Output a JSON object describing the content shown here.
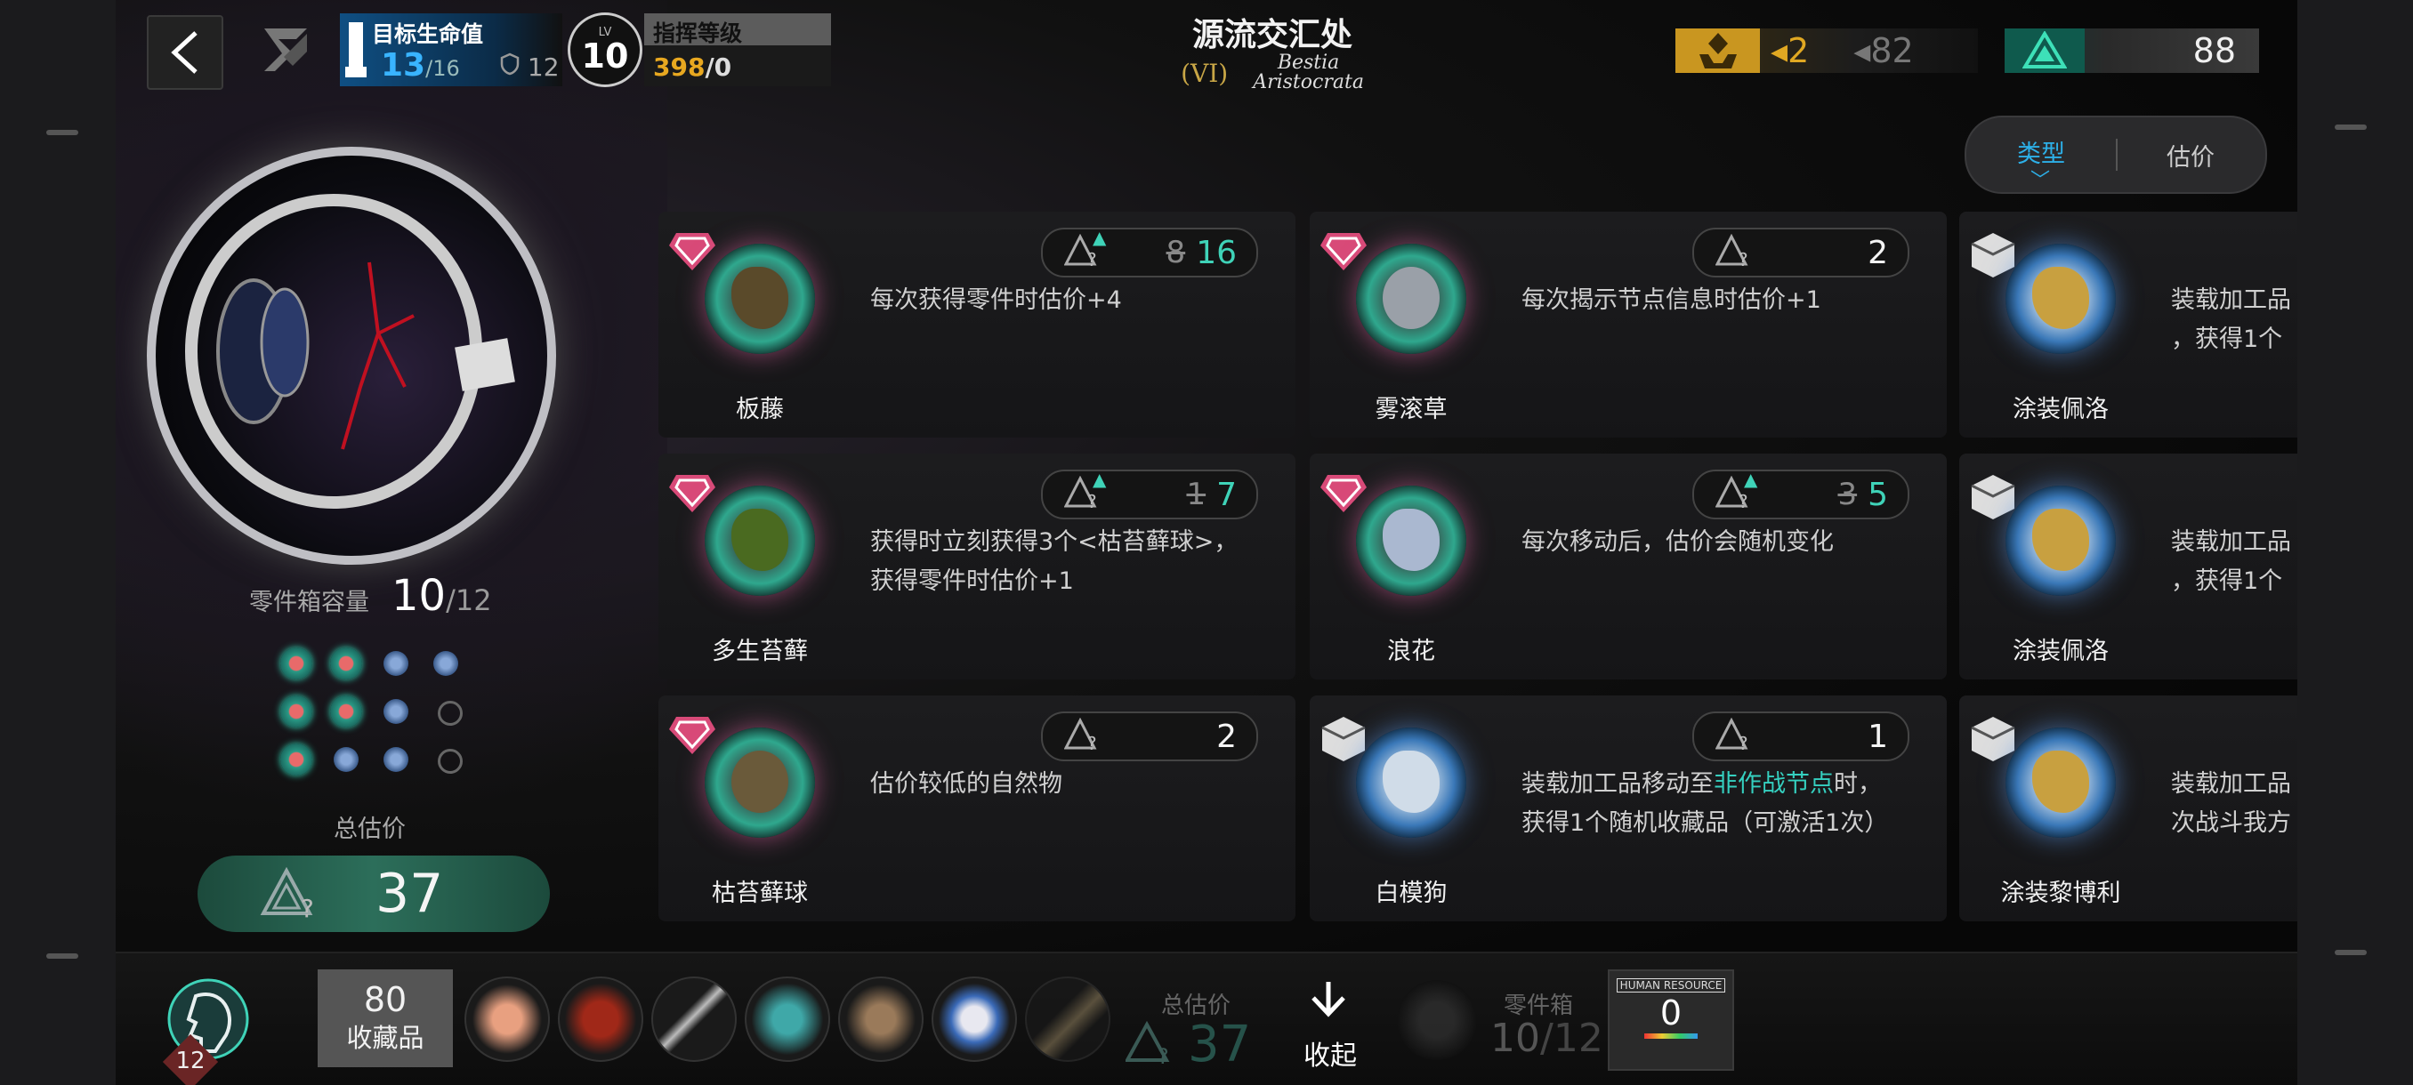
{
  "header": {
    "hp_label": "目标生命值",
    "hp_value": "13",
    "hp_max": "/16",
    "shield_value": "12",
    "lv_small": "LV",
    "lv_value": "10",
    "command_label": "指挥等级",
    "command_value": "398",
    "command_max": "/0"
  },
  "zone": {
    "title": "源流交汇处",
    "roman": "(VI)",
    "script_line1": "Bestia",
    "script_line2": "Aristocrata"
  },
  "resources": {
    "gold_value": "◂2",
    "gold_max": "◂82",
    "green_value": "88"
  },
  "sort": {
    "type_label": "类型",
    "price_label": "估价"
  },
  "left": {
    "capacity_label": "零件箱容量",
    "capacity_value": "10",
    "capacity_max": "/12",
    "total_label": "总估价",
    "total_value": "37"
  },
  "cards": [
    {
      "name": "板藤",
      "desc": "每次获得零件时估价+4",
      "price_old": "8",
      "price": "16"
    },
    {
      "name": "雾滚草",
      "desc": "每次揭示节点信息时估价+1",
      "price": "2"
    },
    {
      "name": "涂装佩洛",
      "desc_line1": "装载加工品",
      "desc_line2": "，获得1个"
    },
    {
      "name": "多生苔藓",
      "desc_line1": "获得时立刻获得3个<枯苔藓球>，",
      "desc_line2": "获得零件时估价+1",
      "price_old": "1",
      "price": "7"
    },
    {
      "name": "浪花",
      "desc": "每次移动后，估价会随机变化",
      "price_old": "3",
      "price": "5"
    },
    {
      "name": "涂装佩洛",
      "desc_line1": "装载加工品",
      "desc_line2": "，获得1个"
    },
    {
      "name": "枯苔藓球",
      "desc": "估价较低的自然物",
      "price": "2"
    },
    {
      "name": "白模狗",
      "desc_pre": "装载加工品移动至",
      "desc_hl": "非作战节点",
      "desc_post": "时，",
      "desc_line2": "获得1个随机收藏品（可激活1次）",
      "price": "1"
    },
    {
      "name": "涂装黎博利",
      "desc_line1": "装载加工品",
      "desc_line2": "次战斗我方"
    }
  ],
  "bottom": {
    "avatar_badge": "12",
    "collection_count": "80",
    "collection_label": "收藏品",
    "total_label": "总估价",
    "total_value": "37",
    "collapse_label": "收起",
    "box_label": "零件箱",
    "box_value": "10",
    "box_max": "/12",
    "hr_label": "HUMAN RESOURCE",
    "hr_value": "0"
  },
  "colors": {
    "accent_teal": "#35d0c0",
    "accent_blue": "#2db0e8",
    "gold": "#e0a822",
    "card_bg": "#1c1c1e"
  }
}
